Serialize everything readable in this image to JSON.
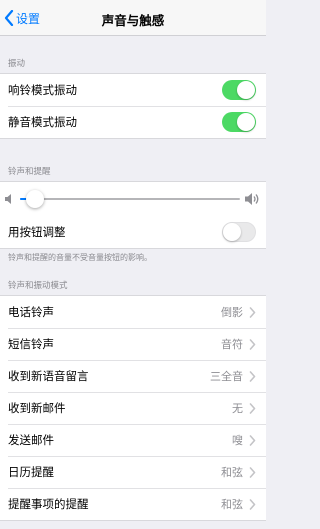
{
  "nav": {
    "back_label": "设置",
    "title": "声音与触感"
  },
  "vibrate": {
    "header": "振动",
    "ring_label": "响铃模式振动",
    "ring_on": true,
    "silent_label": "静音模式振动",
    "silent_on": true
  },
  "ringer": {
    "header": "铃声和提醒",
    "volume_level": 0.07,
    "buttons_label": "用按钮调整",
    "buttons_on": false,
    "note": "铃声和提醒的音量不受音量按钮的影响。"
  },
  "patterns": {
    "header": "铃声和振动模式",
    "items": [
      {
        "label": "电话铃声",
        "value": "倒影"
      },
      {
        "label": "短信铃声",
        "value": "音符"
      },
      {
        "label": "收到新语音留言",
        "value": "三全音"
      },
      {
        "label": "收到新邮件",
        "value": "无"
      },
      {
        "label": "发送邮件",
        "value": "嗖"
      },
      {
        "label": "日历提醒",
        "value": "和弦"
      },
      {
        "label": "提醒事项的提醒",
        "value": "和弦"
      }
    ]
  },
  "colors": {
    "accent": "#007aff",
    "switch_on": "#4cd964",
    "background": "#efeff4"
  }
}
